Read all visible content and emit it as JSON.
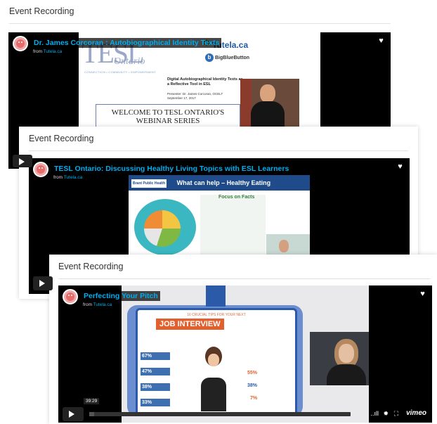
{
  "cards": [
    {
      "title": "Event Recording",
      "video": {
        "title": "Dr. James Corcoran : Autobiographical Identity Texts",
        "from_prefix": "from",
        "from_source": "Tutela.ca"
      },
      "slide": {
        "logo": "TESL",
        "logo_sub": "Ontario",
        "logo_tag": "CONNECTION • COMMUNITY • EMPOWERMENT",
        "tutela": "Tutela.ca",
        "bbb": "BigBlueButton",
        "subtitle": "Digital Autobiographical Identity Texts as a Reflective Tool in ESL",
        "presenter_line1": "Presenter: Dr. James Corcoran, OCELT",
        "presenter_line2": "September 17, 2017",
        "welcome": "WELCOME TO TESL ONTARIO'S WEBINAR SERIES"
      }
    },
    {
      "title": "Event Recording",
      "video": {
        "title": "TESL Ontario: Discussing Healthy Living Topics with ESL Learners",
        "from_prefix": "from",
        "from_source": "Tutela.ca"
      },
      "slide": {
        "org_logo": "Brant Public Health",
        "heading": "What can help – Healthy Eating",
        "focus_title": "Focus on Facts"
      }
    },
    {
      "title": "Event Recording",
      "video": {
        "title": "Perfecting Your Pitch",
        "from_prefix": "from",
        "from_source": "Tutela.ca"
      },
      "slide": {
        "small_heading": "16 CRUCIAL TIPS FOR YOUR NEXT",
        "heading": "JOB INTERVIEW",
        "left_stats": [
          "67%",
          "47%",
          "38%",
          "33%"
        ],
        "right_stats": [
          "55%",
          "38%",
          "7%"
        ]
      },
      "controls": {
        "time": "39:29",
        "brand": "vimeo"
      }
    }
  ],
  "icons": {
    "heart": "♥",
    "volume": "..ıll",
    "settings": "✹",
    "fullscreen": "⛶"
  },
  "colors": {
    "title_blue": "#00adef",
    "header_navy": "#1f4b8a",
    "job_orange": "#e2602e"
  }
}
